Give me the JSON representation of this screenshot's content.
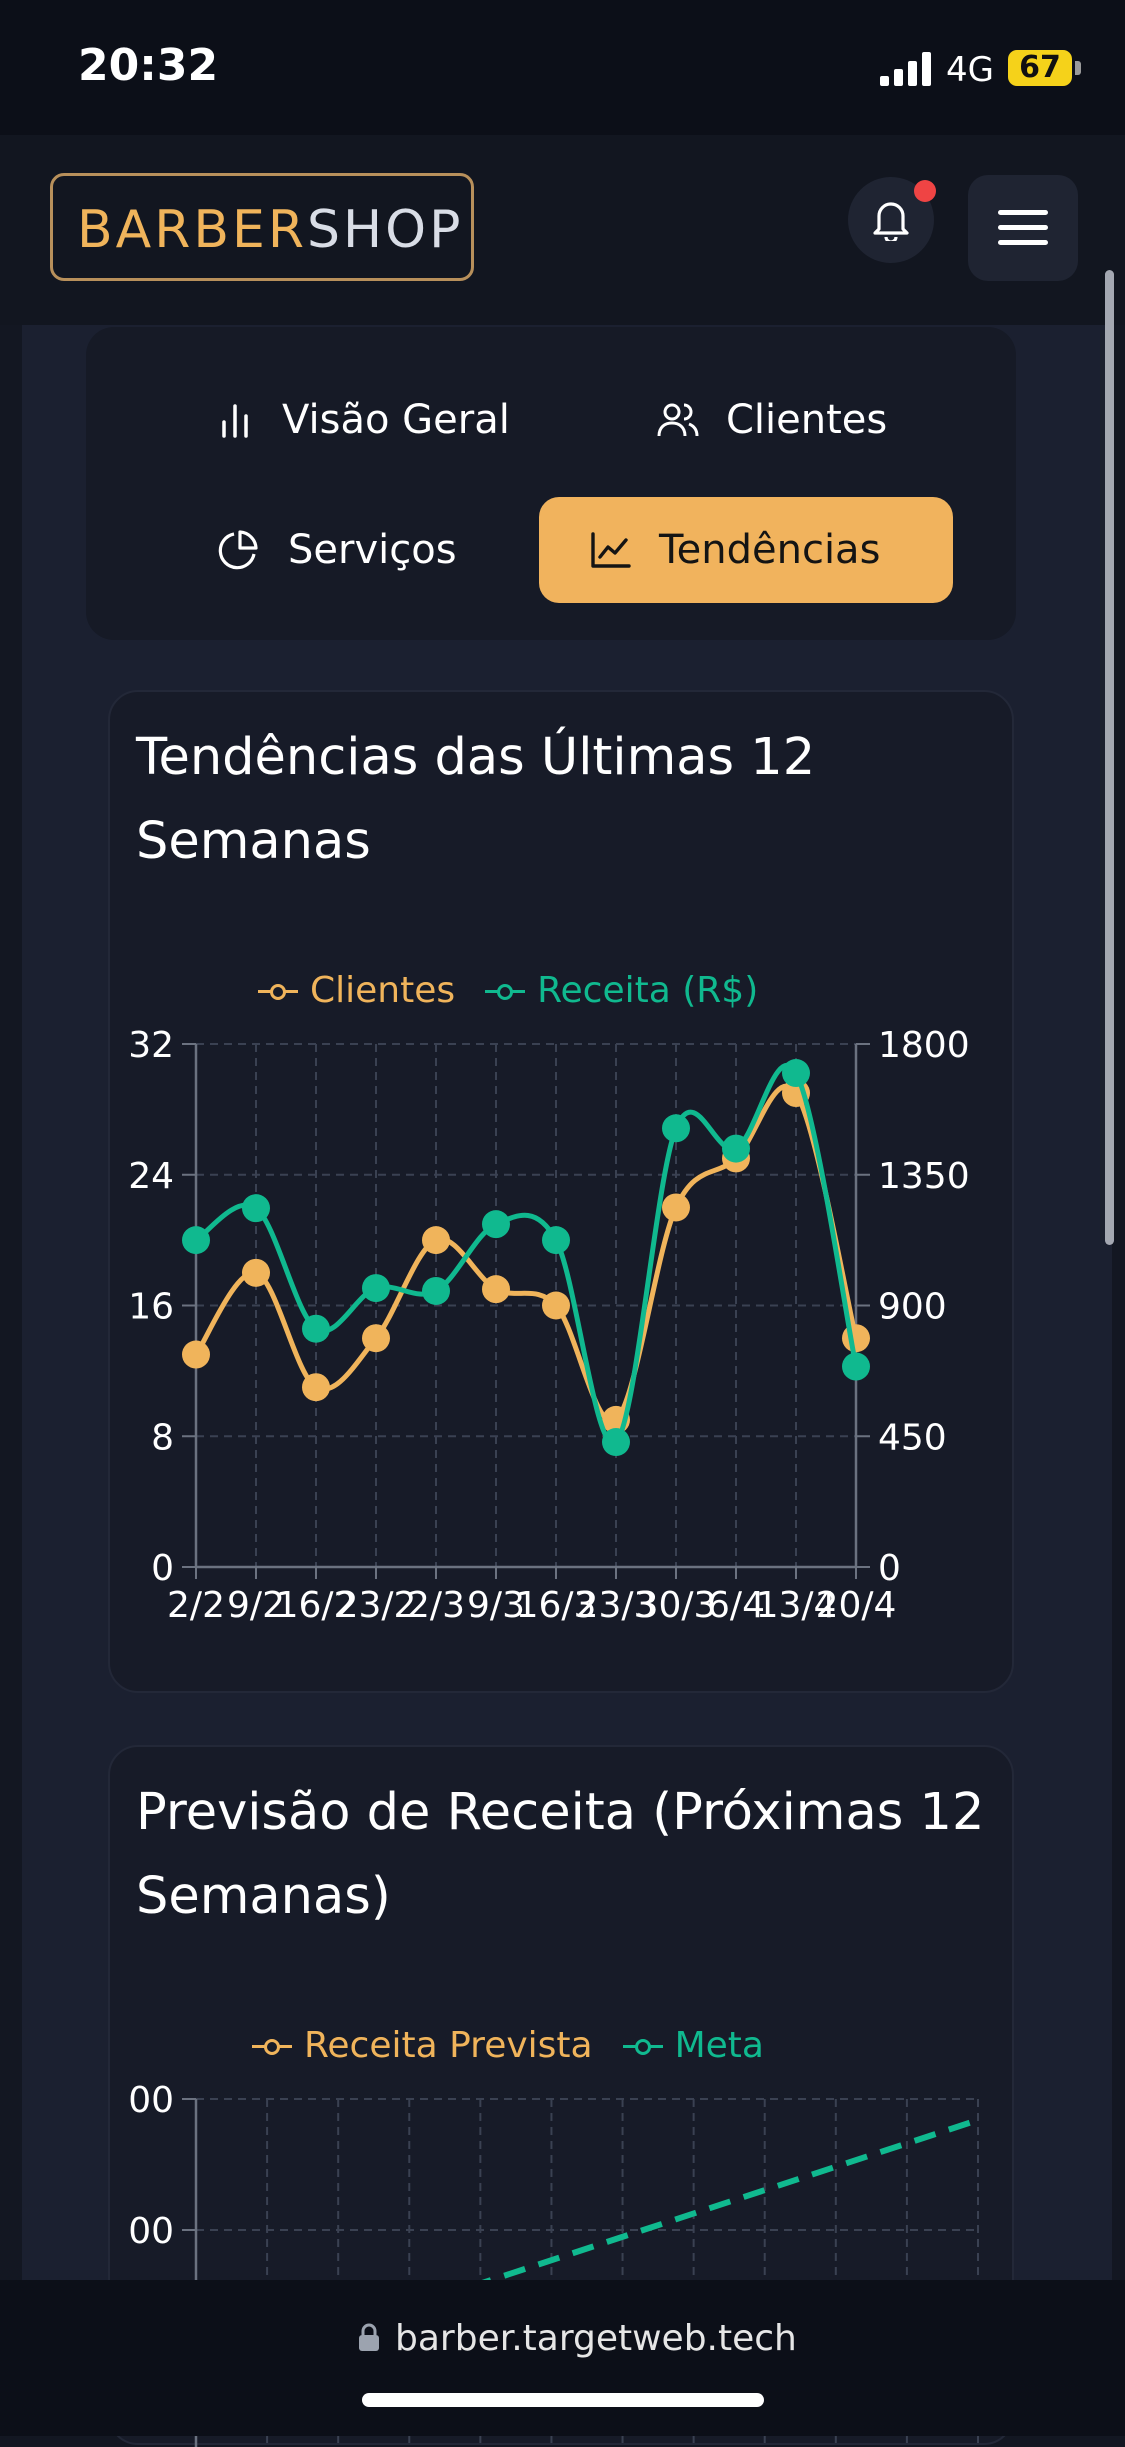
{
  "status": {
    "time": "20:32",
    "network": "4G",
    "battery": "67"
  },
  "header": {
    "logo_part1": "BARBER",
    "logo_part2": "SHOP"
  },
  "tabs": [
    {
      "label": "Visão Geral",
      "icon": "bar-chart-icon",
      "active": false
    },
    {
      "label": "Clientes",
      "icon": "users-icon",
      "active": false
    },
    {
      "label": "Serviços",
      "icon": "pie-chart-icon",
      "active": false
    },
    {
      "label": "Tendências",
      "icon": "line-chart-icon",
      "active": true
    }
  ],
  "trends_card": {
    "title": "Tendências das Últimas 12 Semanas"
  },
  "forecast_card": {
    "title": "Previsão de Receita (Próximas 12 Semanas)"
  },
  "colors": {
    "accent": "#f1b35d",
    "teal": "#10b98f",
    "orange": "#f0b45b",
    "background": "#131722"
  },
  "chart_data": [
    {
      "type": "line",
      "title": "",
      "categories": [
        "2/2",
        "9/2",
        "16/2",
        "23/2",
        "2/3",
        "9/3",
        "16/3",
        "23/3",
        "30/3",
        "6/4",
        "13/4",
        "20/4"
      ],
      "tick_labels": [
        "2/2",
        "9/2",
        "16/2",
        "23/2",
        "2/3",
        "9/3",
        "16/3",
        "23/3",
        "30/3",
        "6/4",
        "13/4",
        "20/4"
      ],
      "series": [
        {
          "name": "Clientes",
          "axis": "left",
          "color": "#f0b45b",
          "values": [
            13,
            18,
            11,
            14,
            20,
            17,
            16,
            9,
            22,
            25,
            29,
            14
          ]
        },
        {
          "name": "Receita (R$)",
          "axis": "right",
          "color": "#10b98f",
          "values": [
            1125,
            1235,
            820,
            960,
            950,
            1180,
            1125,
            430,
            1510,
            1440,
            1700,
            690
          ]
        }
      ],
      "y_left": {
        "min": 0,
        "max": 32,
        "ticks": [
          "0",
          "8",
          "16",
          "24",
          "32"
        ]
      },
      "y_right": {
        "min": 0,
        "max": 1800,
        "ticks": [
          "0",
          "450",
          "900",
          "1350",
          "1800"
        ]
      },
      "grid": true,
      "legend": "top-center"
    },
    {
      "type": "line",
      "title": "",
      "series": [
        {
          "name": "Receita Prevista",
          "color": "#f0b45b"
        },
        {
          "name": "Meta",
          "color": "#10b98f",
          "style": "dashed"
        }
      ],
      "y_tick_fragments": [
        "00",
        "00"
      ],
      "grid": true,
      "legend": "top-center"
    }
  ],
  "browser": {
    "url": "barber.targetweb.tech"
  }
}
